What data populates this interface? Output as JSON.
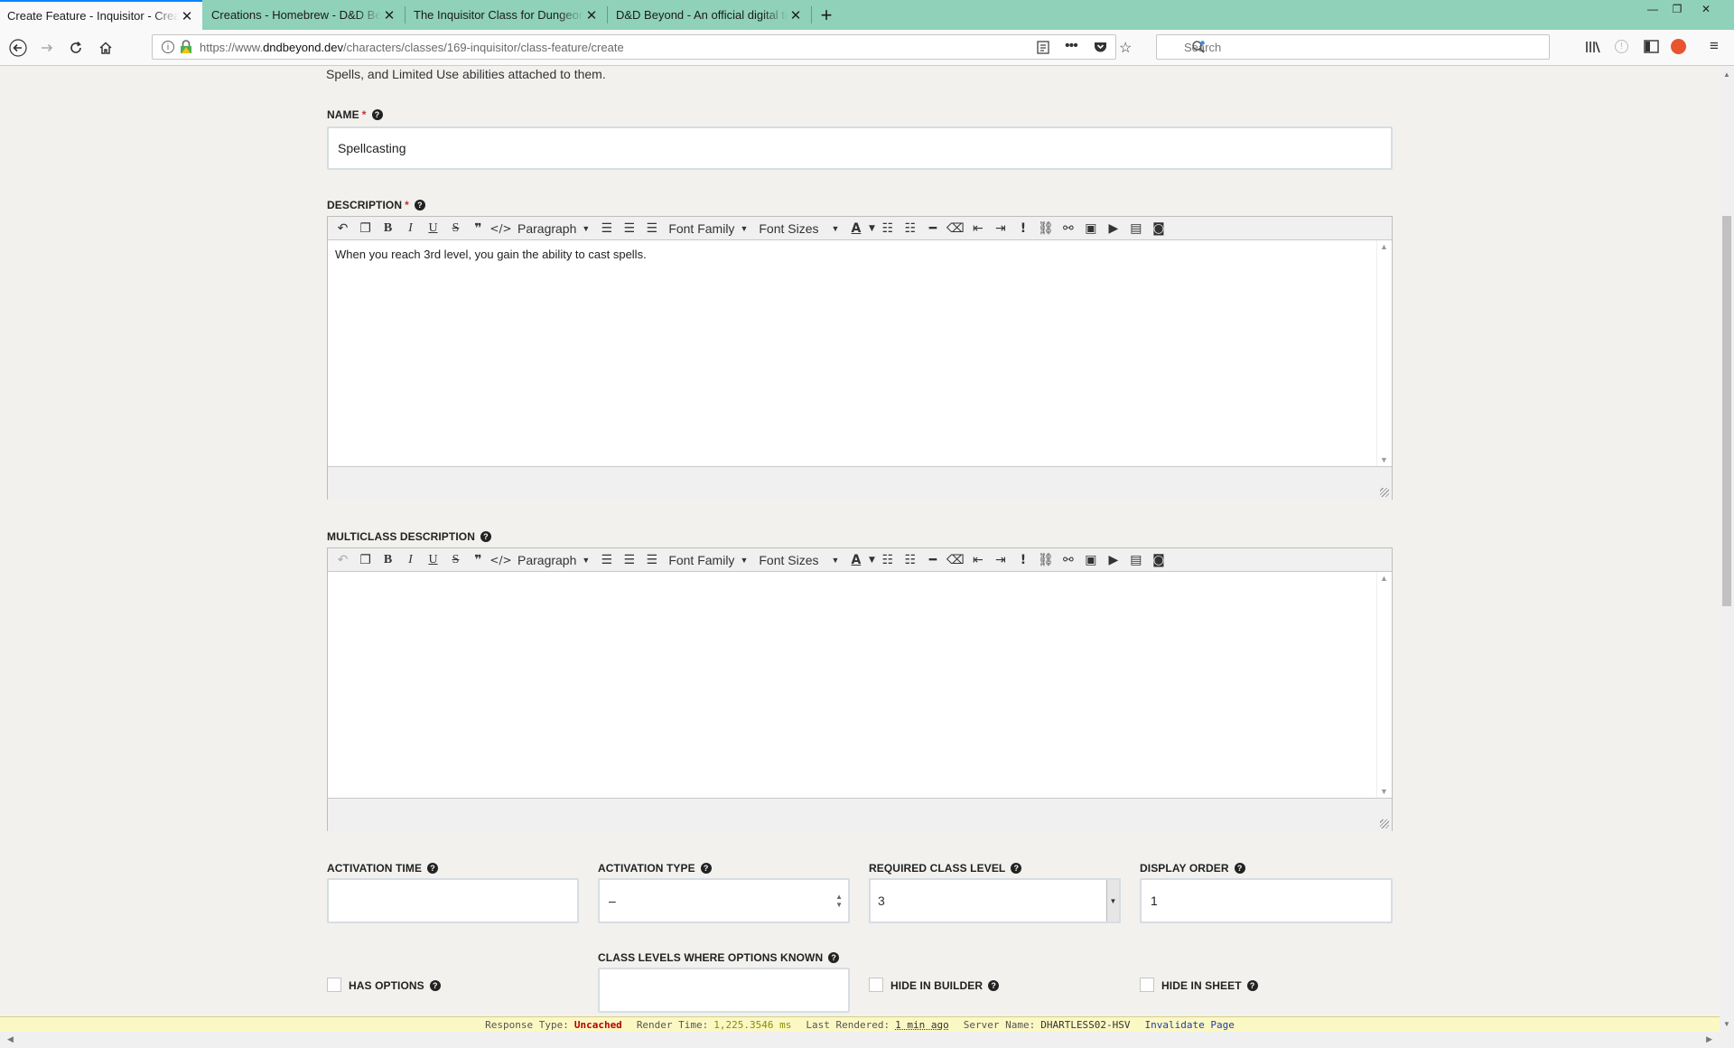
{
  "tabs": [
    {
      "title": "Create Feature - Inquisitor - Creatio",
      "active": true
    },
    {
      "title": "Creations - Homebrew - D&D Beyo",
      "active": false
    },
    {
      "title": "The Inquisitor Class for Dungeons &",
      "active": false
    },
    {
      "title": "D&D Beyond - An official digital to",
      "active": false
    }
  ],
  "nav": {
    "url_prefix": "https://www.",
    "url_domain": "dndbeyond.dev",
    "url_path": "/characters/classes/169-inquisitor/class-feature/create",
    "search_placeholder": "Search"
  },
  "intro_text": "Spells, and Limited Use abilities attached to them.",
  "name_field": {
    "label": "NAME",
    "value": "Spellcasting"
  },
  "description": {
    "label": "DESCRIPTION",
    "text": "When you reach 3rd level, you gain the ability to cast spells."
  },
  "multiclass_description": {
    "label": "MULTICLASS DESCRIPTION",
    "text": ""
  },
  "toolbar": {
    "paragraph": "Paragraph",
    "font_family": "Font Family",
    "font_sizes": "Font Sizes"
  },
  "activation_time": {
    "label": "ACTIVATION TIME",
    "value": ""
  },
  "activation_type": {
    "label": "ACTIVATION TYPE",
    "value": "–"
  },
  "required_class_level": {
    "label": "REQUIRED CLASS LEVEL",
    "value": "3"
  },
  "display_order": {
    "label": "DISPLAY ORDER",
    "value": "1"
  },
  "class_levels_options": {
    "label": "CLASS LEVELS WHERE OPTIONS KNOWN",
    "value": ""
  },
  "has_options": {
    "label": "HAS OPTIONS",
    "checked": false
  },
  "hide_in_builder": {
    "label": "HIDE IN BUILDER",
    "checked": false
  },
  "hide_in_sheet": {
    "label": "HIDE IN SHEET",
    "checked": false
  },
  "debug": {
    "response_type_label": "Response Type:",
    "response_type": "Uncached",
    "render_time_label": "Render Time:",
    "render_time": "1,225.3546 ms",
    "last_rendered_label": "Last Rendered:",
    "last_rendered": "1 min ago",
    "server_name_label": "Server Name:",
    "server_name": "DHARTLESS02-HSV",
    "invalidate": "Invalidate Page"
  }
}
